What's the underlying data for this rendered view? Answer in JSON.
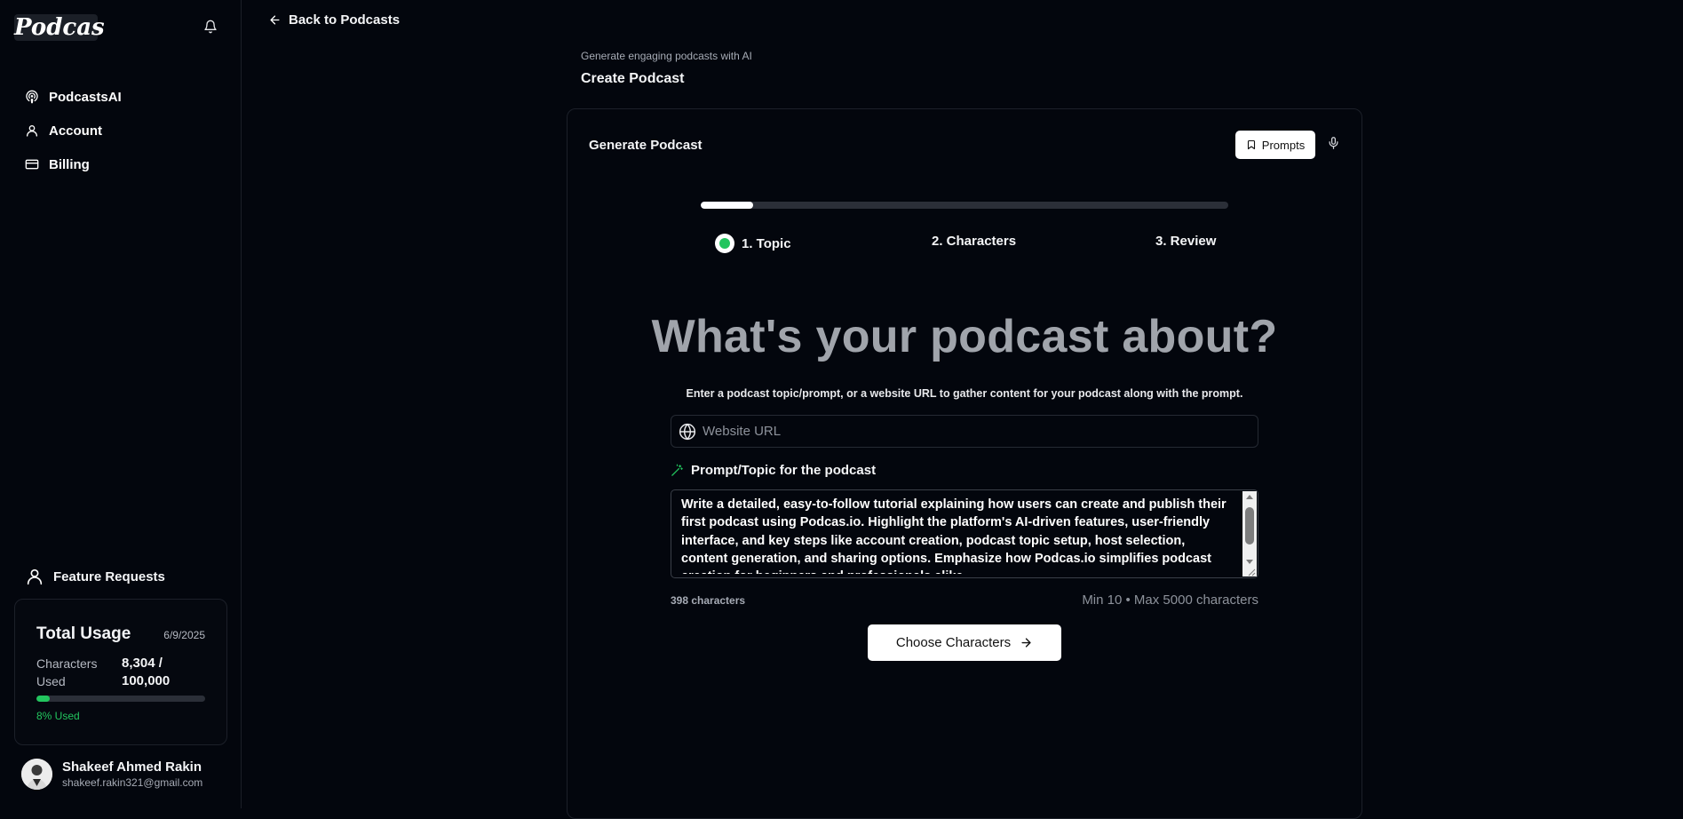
{
  "sidebar": {
    "logo": "Podcas",
    "nav": [
      {
        "label": "PodcastsAI",
        "icon": "podcast-icon"
      },
      {
        "label": "Account",
        "icon": "user-icon"
      },
      {
        "label": "Billing",
        "icon": "credit-card-icon"
      }
    ],
    "feature_requests": "Feature Requests",
    "usage": {
      "title": "Total Usage",
      "date": "6/9/2025",
      "label": "Characters Used",
      "value": "8,304 / 100,000",
      "percent": 8,
      "percent_label": "8% Used"
    },
    "user": {
      "name": "Shakeef Ahmed Rakin",
      "email": "shakeef.rakin321@gmail.com"
    }
  },
  "header": {
    "back": "Back to Podcasts",
    "subtitle": "Generate engaging podcasts with AI",
    "title": "Create Podcast"
  },
  "card": {
    "title": "Generate Podcast",
    "prompts_button": "Prompts",
    "progress_percent": 10,
    "steps": [
      "1. Topic",
      "2. Characters",
      "3. Review"
    ],
    "hero": "What's your podcast about?",
    "description": "Enter a podcast topic/prompt, or a website URL to gather content for your podcast along with the prompt.",
    "url_placeholder": "Website URL",
    "prompt_label": "Prompt/Topic for the podcast",
    "prompt_text": "Write a detailed, easy-to-follow tutorial explaining how users can create and publish their first podcast using Podcas.io. Highlight the platform's AI-driven features, user-friendly interface, and key steps like account creation, podcast topic setup, host selection, content generation, and sharing options. Emphasize how Podcas.io simplifies podcast creation for beginners and professionals alike.",
    "char_count": "398 characters",
    "char_limit": "Min 10 • Max 5000 characters",
    "choose_button": "Choose Characters"
  },
  "colors": {
    "background": "#03060d",
    "accent": "#22c55e",
    "border": "#1c2029"
  }
}
